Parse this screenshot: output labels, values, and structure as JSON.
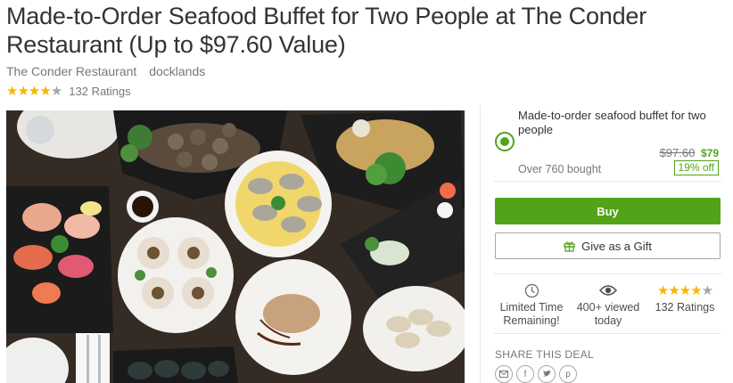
{
  "deal": {
    "title": "Made-to-Order Seafood Buffet for Two People at The Conder Restaurant (Up to $97.60 Value)",
    "merchant": "The Conder Restaurant",
    "location": "docklands",
    "rating": 4,
    "rating_max": 5,
    "ratings_count": "132 Ratings"
  },
  "option": {
    "title": "Made-to-order seafood buffet for two people",
    "original_price": "$97.60",
    "price": "$79",
    "bought": "Over 760 bought",
    "discount": "19% off",
    "selected": true
  },
  "actions": {
    "buy_label": "Buy",
    "gift_label": "Give as a Gift"
  },
  "stats": {
    "limited_time": "Limited Time Remaining!",
    "viewed": "400+ viewed today",
    "ratings": "132 Ratings"
  },
  "share": {
    "label": "SHARE THIS DEAL",
    "icons": [
      "email-icon",
      "facebook-icon",
      "twitter-icon",
      "pinterest-icon"
    ]
  },
  "colors": {
    "accent": "#53a318",
    "star": "#f7b500",
    "star_off": "#a5a8ab"
  }
}
